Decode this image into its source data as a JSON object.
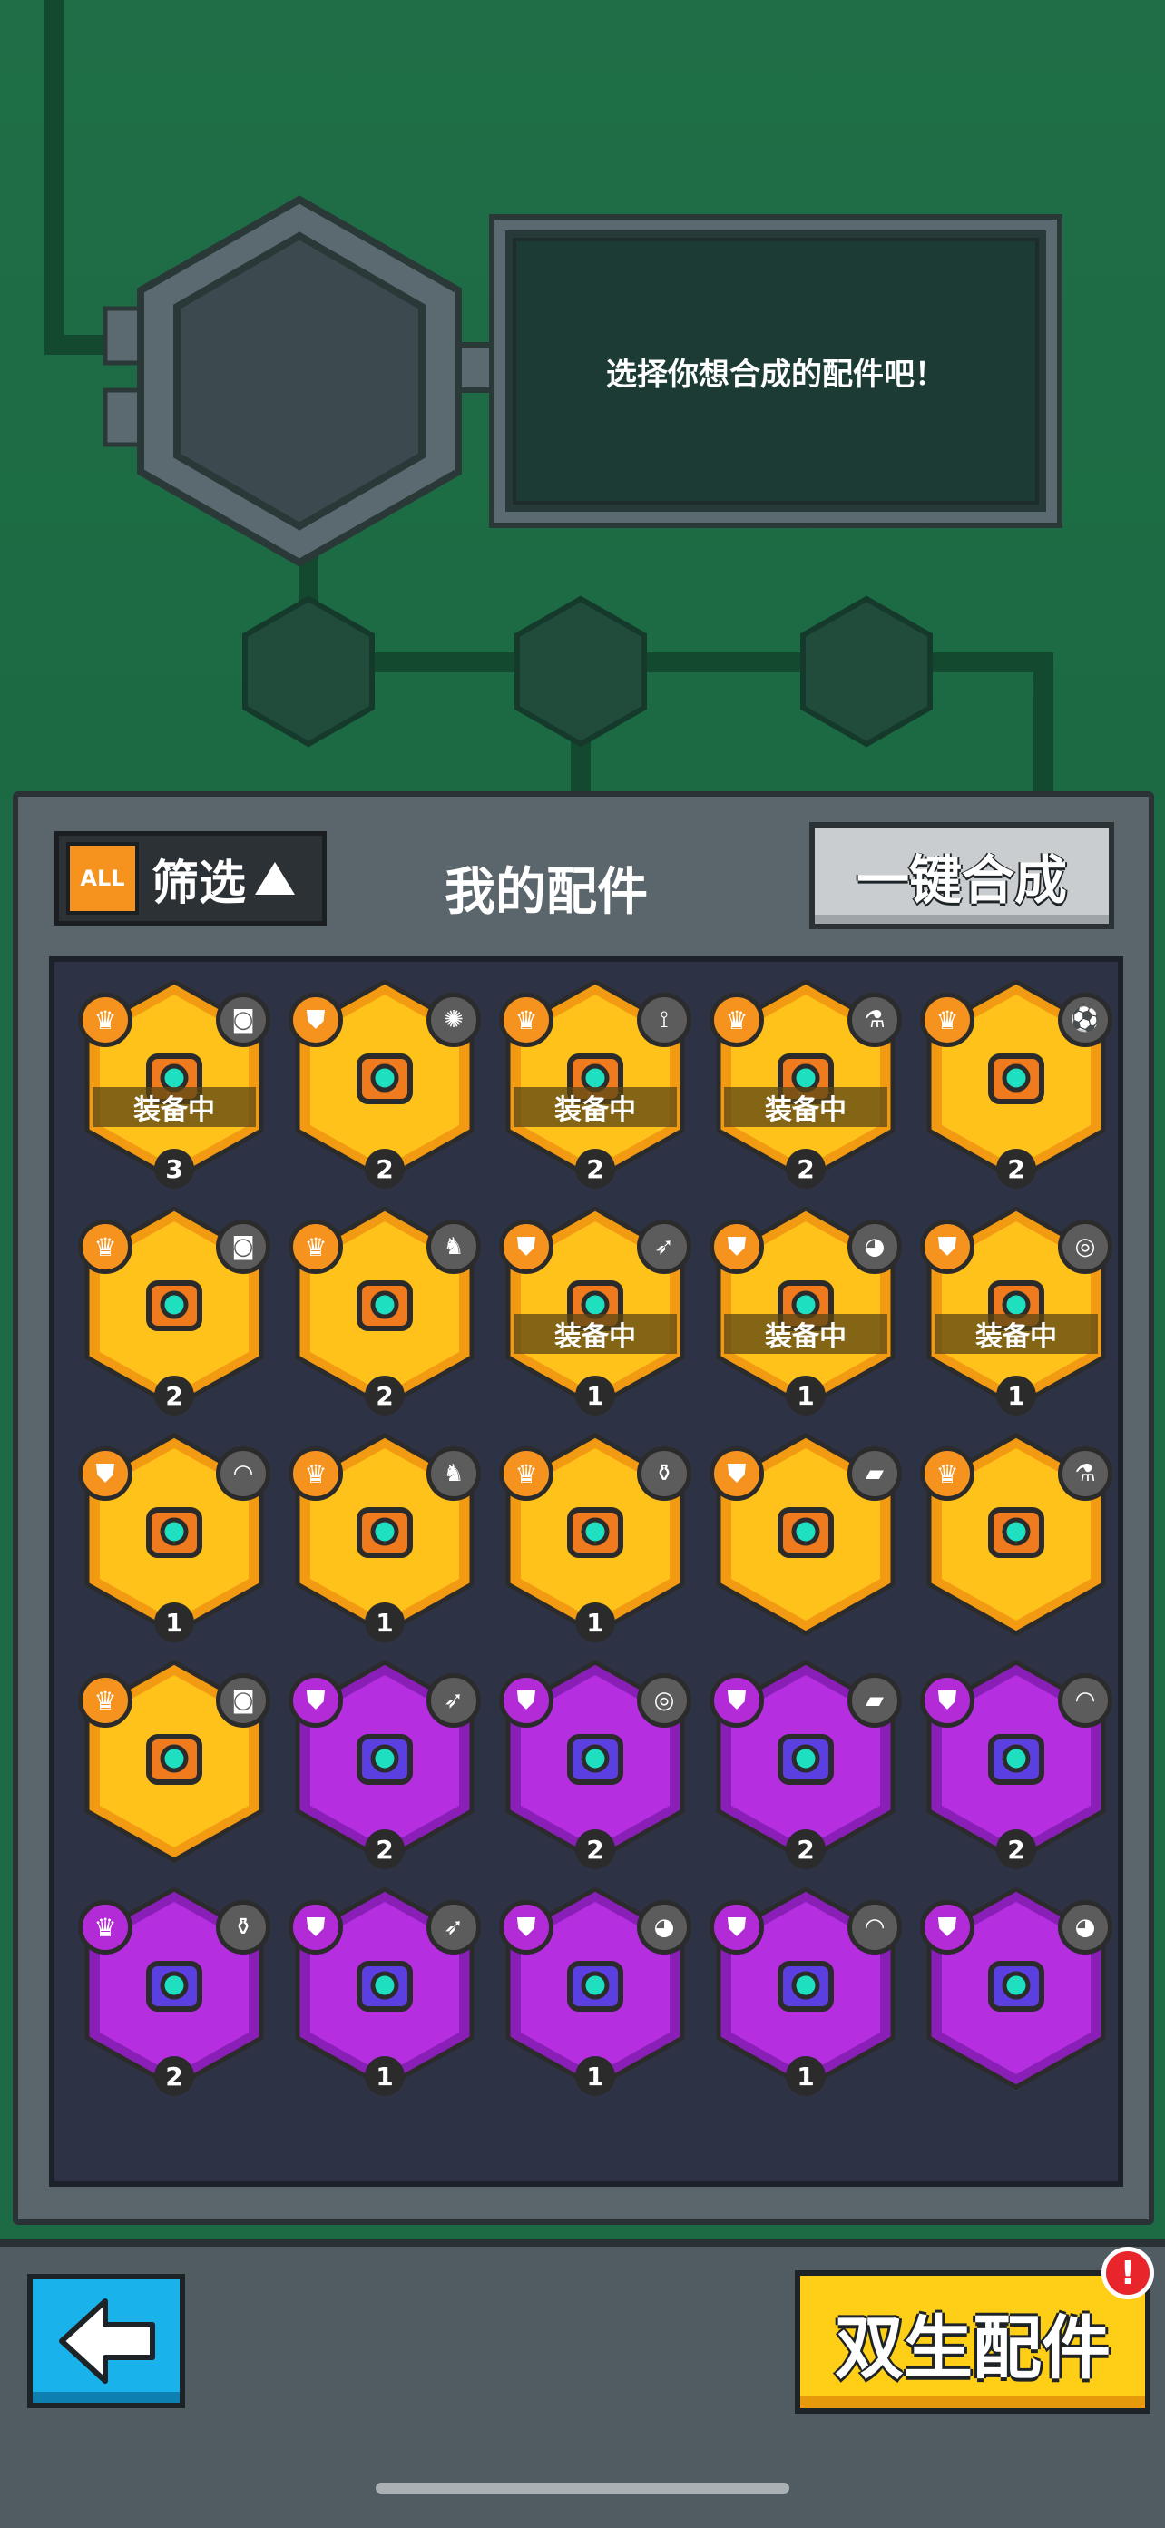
{
  "message": "选择你想合成的配件吧！",
  "panel": {
    "filter_all": "ALL",
    "filter_label": "筛选",
    "title": "我的配件",
    "merge_button": "一键合成"
  },
  "equipped_label": "装备中",
  "cards": [
    {
      "rarity": "gold",
      "badge": "crown",
      "skin": "camera",
      "equipped": true,
      "level": "3"
    },
    {
      "rarity": "gold",
      "badge": "shield",
      "skin": "virus",
      "equipped": false,
      "level": "2"
    },
    {
      "rarity": "gold",
      "badge": "crown",
      "skin": "drill",
      "equipped": true,
      "level": "2"
    },
    {
      "rarity": "gold",
      "badge": "crown",
      "skin": "potion",
      "equipped": true,
      "level": "2"
    },
    {
      "rarity": "gold",
      "badge": "crown",
      "skin": "ball",
      "equipped": false,
      "level": "2"
    },
    {
      "rarity": "gold",
      "badge": "crown",
      "skin": "camera",
      "equipped": false,
      "level": "2"
    },
    {
      "rarity": "gold",
      "badge": "crown",
      "skin": "boot",
      "equipped": false,
      "level": "2"
    },
    {
      "rarity": "gold",
      "badge": "shield",
      "skin": "rocket",
      "equipped": true,
      "level": "1"
    },
    {
      "rarity": "gold",
      "badge": "shield",
      "skin": "melon",
      "equipped": true,
      "level": "1"
    },
    {
      "rarity": "gold",
      "badge": "shield",
      "skin": "target",
      "equipped": true,
      "level": "1"
    },
    {
      "rarity": "gold",
      "badge": "shield",
      "skin": "arc",
      "equipped": false,
      "level": "1"
    },
    {
      "rarity": "gold",
      "badge": "crown",
      "skin": "boot",
      "equipped": false,
      "level": "1"
    },
    {
      "rarity": "gold",
      "badge": "crown",
      "skin": "bottle",
      "equipped": false,
      "level": "1"
    },
    {
      "rarity": "gold",
      "badge": "shield",
      "skin": "brick",
      "equipped": false,
      "level": ""
    },
    {
      "rarity": "gold",
      "badge": "crown",
      "skin": "potion",
      "equipped": false,
      "level": ""
    },
    {
      "rarity": "gold",
      "badge": "crown",
      "skin": "camera",
      "equipped": false,
      "level": ""
    },
    {
      "rarity": "purple",
      "badge": "shield",
      "skin": "rocket",
      "equipped": false,
      "level": "2"
    },
    {
      "rarity": "purple",
      "badge": "shield",
      "skin": "target",
      "equipped": false,
      "level": "2"
    },
    {
      "rarity": "purple",
      "badge": "shield",
      "skin": "brick",
      "equipped": false,
      "level": "2"
    },
    {
      "rarity": "purple",
      "badge": "shield",
      "skin": "arc",
      "equipped": false,
      "level": "2"
    },
    {
      "rarity": "purple",
      "badge": "crown",
      "skin": "bottle",
      "equipped": false,
      "level": "2"
    },
    {
      "rarity": "purple",
      "badge": "shield",
      "skin": "rocket",
      "equipped": false,
      "level": "1"
    },
    {
      "rarity": "purple",
      "badge": "shield",
      "skin": "melon",
      "equipped": false,
      "level": "1"
    },
    {
      "rarity": "purple",
      "badge": "shield",
      "skin": "arc",
      "equipped": false,
      "level": "1"
    },
    {
      "rarity": "purple",
      "badge": "shield",
      "skin": "melon",
      "equipped": false,
      "level": ""
    }
  ],
  "twin_button": "双生配件",
  "alert": "!",
  "colors": {
    "gold": "#ffc21a",
    "gold_rim": "#f29a12",
    "purple": "#b52ee0",
    "purple_rim": "#8a1fb8",
    "accent": "#f6921e"
  }
}
